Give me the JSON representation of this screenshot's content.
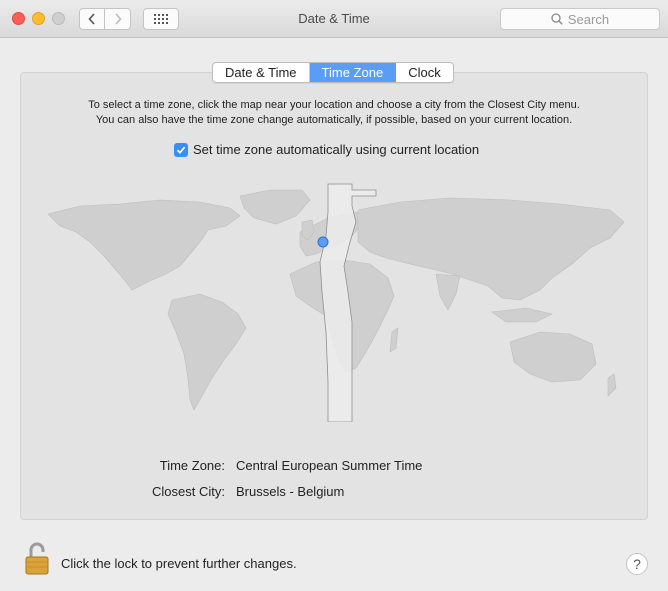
{
  "window": {
    "title": "Date & Time"
  },
  "toolbar": {
    "back_icon": "chevron-left-icon",
    "forward_icon": "chevron-right-icon",
    "show_all_icon": "grid-icon",
    "search_placeholder": "Search"
  },
  "tabs": [
    {
      "label": "Date & Time",
      "active": false
    },
    {
      "label": "Time Zone",
      "active": true
    },
    {
      "label": "Clock",
      "active": false
    }
  ],
  "description": {
    "line1": "To select a time zone, click the map near your location and choose a city from the Closest City menu.",
    "line2": "You can also have the time zone change automatically, if possible, based on your current location."
  },
  "auto_timezone": {
    "label": "Set time zone automatically using current location",
    "checked": true
  },
  "info": {
    "time_zone_label": "Time Zone:",
    "time_zone_value": "Central European Summer Time",
    "closest_city_label": "Closest City:",
    "closest_city_value": "Brussels - Belgium"
  },
  "footer": {
    "lock_text": "Click the lock to prevent further changes.",
    "help_label": "?"
  },
  "colors": {
    "accent": "#5a9df5",
    "checkbox": "#3b8ef5",
    "map_land": "#cfcfcf",
    "selected_zone": "#ececec"
  }
}
